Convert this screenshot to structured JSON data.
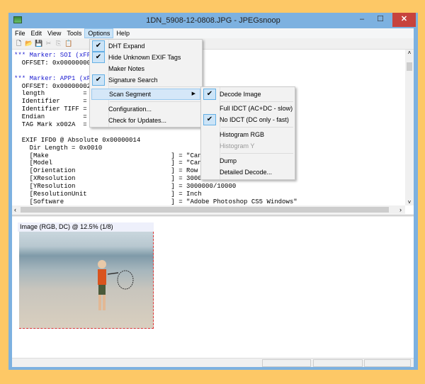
{
  "window": {
    "title": "1DN_5908-12-0808.JPG - JPEGsnoop",
    "minimize": "–",
    "maximize": "☐",
    "close": "✕"
  },
  "menubar": [
    "File",
    "Edit",
    "View",
    "Tools",
    "Options",
    "Help"
  ],
  "toolbar": {
    "new": "🗋",
    "open": "📂",
    "save": "💾",
    "cut": "✂",
    "copy": "⎘",
    "paste": "📋"
  },
  "text_lines": [
    {
      "t": "*** Marker: SOI (xFF",
      "c": "blue"
    },
    {
      "t": "  OFFSET: 0x00000000",
      "c": ""
    },
    {
      "t": "",
      "c": ""
    },
    {
      "t": "*** Marker: APP1 (xF",
      "c": "blue"
    },
    {
      "t": "  OFFSET: 0x00000002",
      "c": ""
    },
    {
      "t": "  length          =",
      "c": ""
    },
    {
      "t": "  Identifier      =",
      "c": ""
    },
    {
      "t": "  Identifier TIFF =",
      "c": ""
    },
    {
      "t": "  Endian          =",
      "c": ""
    },
    {
      "t": "  TAG Mark x002A  =",
      "c": ""
    },
    {
      "t": "",
      "c": ""
    },
    {
      "t": "  EXIF IFD0 @ Absolute 0x00000014",
      "c": ""
    },
    {
      "t": "    Dir Length = 0x0010",
      "c": ""
    },
    {
      "t": "    [Make                                ] = \"Canon",
      "c": ""
    },
    {
      "t": "    [Model                               ] = \"Canon",
      "c": ""
    },
    {
      "t": "    [Orientation                         ] = Row 0",
      "c": ""
    },
    {
      "t": "    [XResolution                         ] = 3000000/10000",
      "c": ""
    },
    {
      "t": "    [YResolution                         ] = 3000000/10000",
      "c": ""
    },
    {
      "t": "    [ResolutionUnit                      ] = Inch",
      "c": ""
    },
    {
      "t": "    [Software                            ] = \"Adobe Photoshop CS5 Windows\"",
      "c": ""
    }
  ],
  "image_pane": {
    "label": "Image (RGB, DC) @ 12.5% (1/8)"
  },
  "options_menu": {
    "items": [
      {
        "label": "DHT Expand",
        "checked": true
      },
      {
        "label": "Hide Unknown EXIF Tags",
        "checked": true
      },
      {
        "label": "Maker Notes",
        "checked": false
      },
      {
        "label": "Signature Search",
        "checked": true
      },
      {
        "label": "Scan Segment",
        "checked": false
      },
      {
        "label": "Configuration...",
        "checked": false
      },
      {
        "label": "Check for Updates...",
        "checked": false
      }
    ]
  },
  "scan_submenu": {
    "items": [
      {
        "label": "Decode Image",
        "checked": true
      },
      {
        "label": "Full IDCT (AC+DC - slow)",
        "checked": false
      },
      {
        "label": "No IDCT (DC only - fast)",
        "checked": true
      },
      {
        "label": "Histogram RGB",
        "checked": false
      },
      {
        "label": "Histogram Y",
        "checked": false,
        "disabled": true
      },
      {
        "label": "Dump",
        "checked": false
      },
      {
        "label": "Detailed Decode...",
        "checked": false
      }
    ]
  },
  "check_glyph": "✔",
  "submenu_arrow": "▶",
  "scroll": {
    "left": "‹",
    "right": "›",
    "up": "˄",
    "down": "˅"
  }
}
